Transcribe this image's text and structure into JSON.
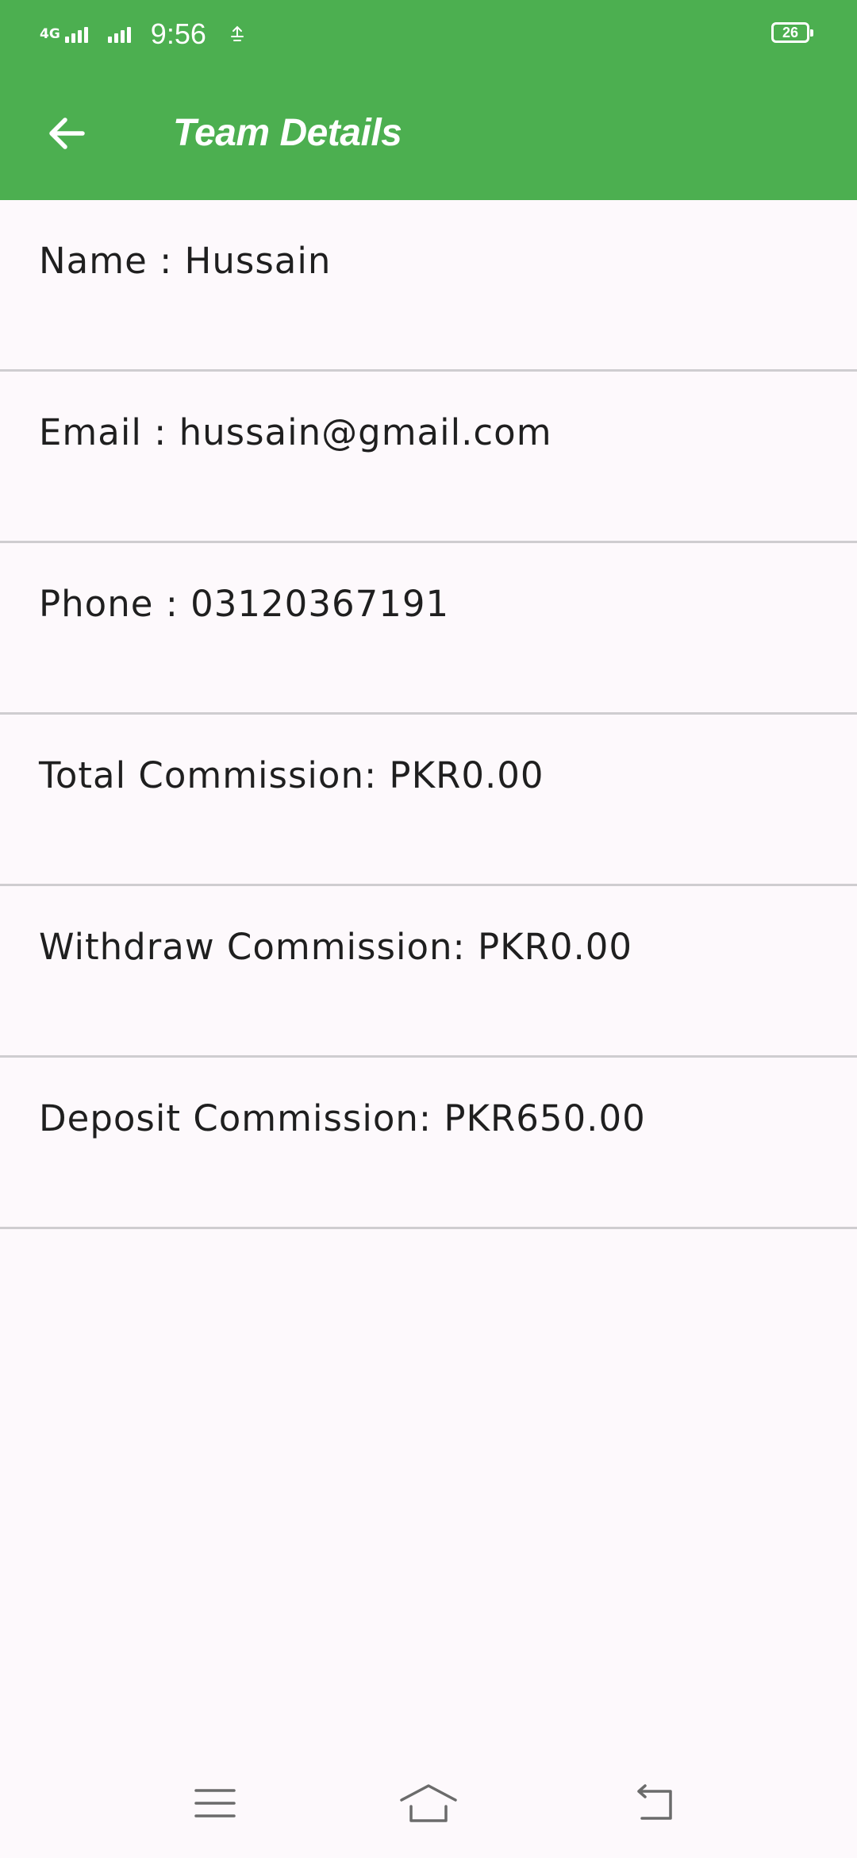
{
  "status_bar": {
    "network_type": "4G",
    "time": "9:56",
    "battery_level": "26"
  },
  "toolbar": {
    "title": "Team Details",
    "back_icon": "arrow-left-icon"
  },
  "details": [
    {
      "text": "Name : Hussain"
    },
    {
      "text": "Email : hussain@gmail.com"
    },
    {
      "text": "Phone : 03120367191"
    },
    {
      "text": "Total Commission: PKR0.00"
    },
    {
      "text": "Withdraw Commission: PKR0.00"
    },
    {
      "text": "Deposit Commission: PKR650.00"
    }
  ],
  "nav_bar": {
    "icons": [
      "menu-icon",
      "home-icon",
      "back-icon"
    ]
  },
  "colors": {
    "primary": "#4caf50",
    "background": "#fdf9fc",
    "divider": "#cfcdd0",
    "text": "#1f1f1f"
  }
}
